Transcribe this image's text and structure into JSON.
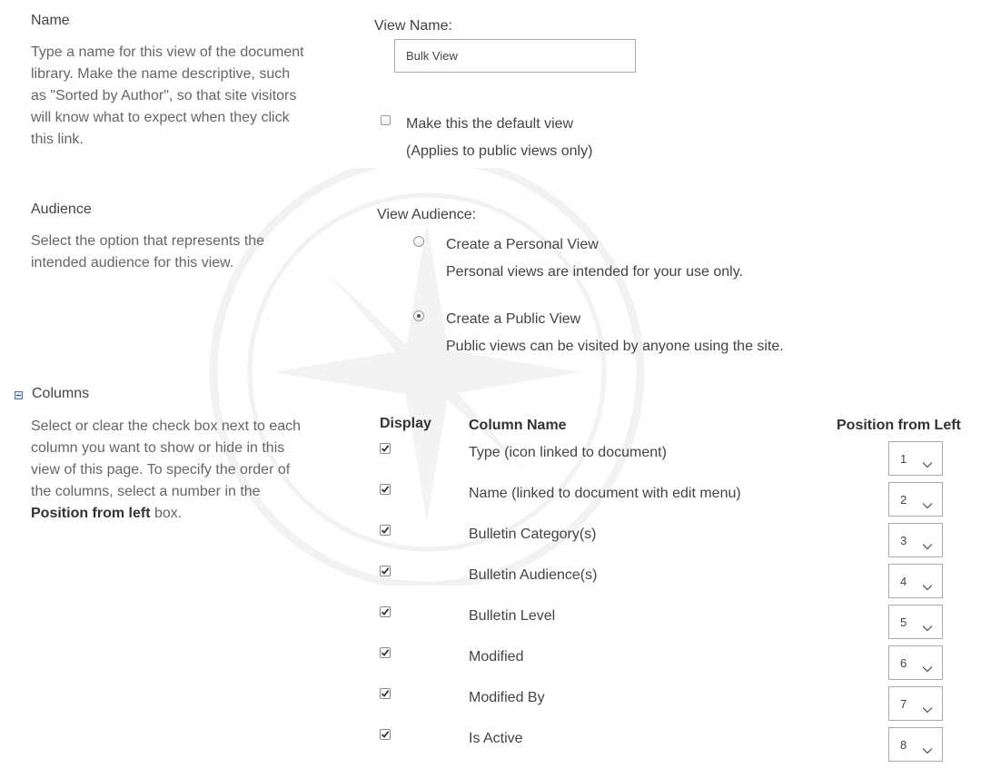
{
  "name_section": {
    "title": "Name",
    "description": "Type a name for this view of the document library. Make the name descriptive, such as \"Sorted by Author\", so that site visitors will know what to expect when they click this link.",
    "view_name_label": "View Name:",
    "view_name_value": "Bulk View",
    "default_view_label": "Make this the default view",
    "default_view_note": "(Applies to public views only)",
    "default_view_checked": false
  },
  "audience_section": {
    "title": "Audience",
    "description": "Select the option that represents the intended audience for this view.",
    "view_audience_label": "View Audience:",
    "options": [
      {
        "label": "Create a Personal View",
        "note": "Personal views are intended for your use only.",
        "selected": false
      },
      {
        "label": "Create a Public View",
        "note": "Public views can be visited by anyone using the site.",
        "selected": true
      }
    ]
  },
  "columns_section": {
    "title": "Columns",
    "description_part1": "Select or clear the check box next to each column you want to show or hide in this view of this page. To specify the order of the columns, select a number in the ",
    "description_bold": "Position from left",
    "description_part2": " box.",
    "headers": {
      "display": "Display",
      "column_name": "Column Name",
      "position": "Position from Left"
    },
    "rows": [
      {
        "display": true,
        "name": "Type (icon linked to document)",
        "position": "1"
      },
      {
        "display": true,
        "name": "Name (linked to document with edit menu)",
        "position": "2"
      },
      {
        "display": true,
        "name": "Bulletin Category(s)",
        "position": "3"
      },
      {
        "display": true,
        "name": "Bulletin Audience(s)",
        "position": "4"
      },
      {
        "display": true,
        "name": "Bulletin Level",
        "position": "5"
      },
      {
        "display": true,
        "name": "Modified",
        "position": "6"
      },
      {
        "display": true,
        "name": "Modified By",
        "position": "7"
      },
      {
        "display": true,
        "name": "Is Active",
        "position": "8"
      }
    ]
  },
  "icons": {
    "collapse": "collapse-minus-icon",
    "checkmark": "checkmark-icon",
    "dropdown": "chevron-down-icon",
    "watermark": "compass-star-watermark"
  },
  "colors": {
    "text": "#444444",
    "description": "#666666",
    "border": "#ababab"
  }
}
